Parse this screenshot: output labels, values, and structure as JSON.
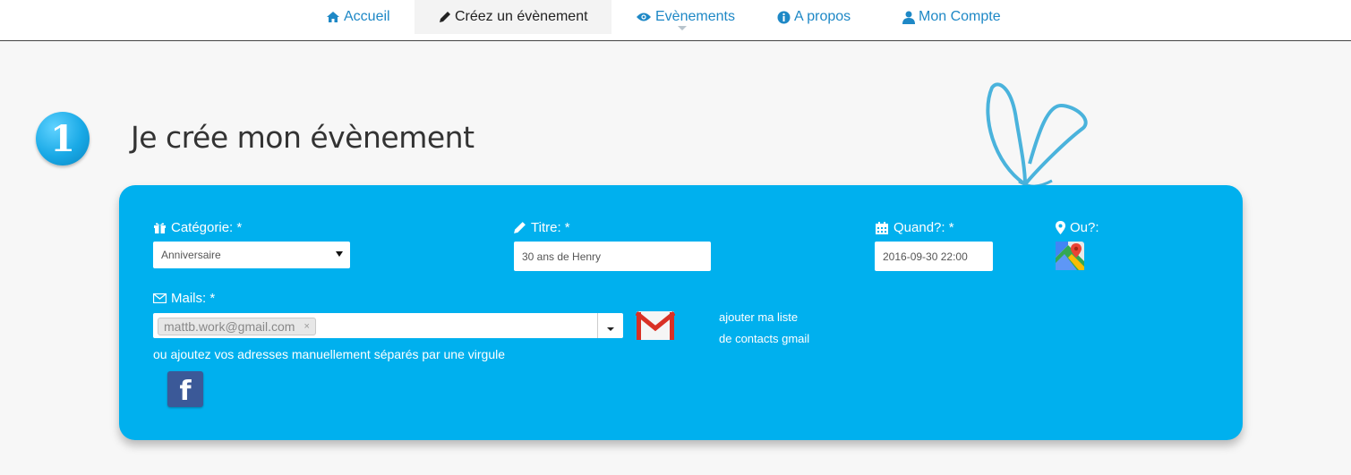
{
  "nav": {
    "items": [
      {
        "label": "Accueil",
        "icon": "home-icon"
      },
      {
        "label": "Créez un évènement",
        "icon": "pencil-icon"
      },
      {
        "label": "Evènements",
        "icon": "eye-icon"
      },
      {
        "label": "A propos",
        "icon": "info-icon"
      },
      {
        "label": "Mon Compte",
        "icon": "user-icon"
      }
    ]
  },
  "heading": {
    "step": "1",
    "title": "Je crée mon évènement"
  },
  "form": {
    "category": {
      "label": "Catégorie: *",
      "value": "Anniversaire"
    },
    "title": {
      "label": "Titre: *",
      "value": "30 ans de Henry"
    },
    "when": {
      "label": "Quand?: *",
      "value": "2016-09-30 22:00"
    },
    "where": {
      "label": "Ou?:"
    },
    "mails": {
      "label": "Mails: *",
      "tags": [
        "mattb.work@gmail.com"
      ],
      "remove_glyph": "×"
    },
    "gmail": {
      "line1": "ajouter ma liste",
      "line2": "de contacts gmail"
    },
    "hint": "ou ajoutez vos adresses manuellement séparés par une virgule",
    "facebook_glyph": "f"
  },
  "colors": {
    "accent": "#00b0ee",
    "nav_link": "#1e88c6",
    "background": "#f7f7f7"
  }
}
